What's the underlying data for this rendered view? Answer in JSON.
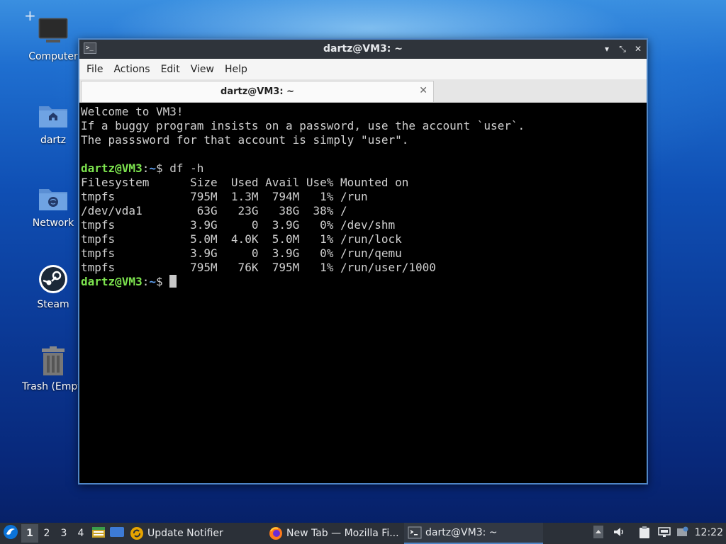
{
  "desktop": {
    "icons": [
      {
        "label": "Computer",
        "icon": "monitor-icon"
      },
      {
        "label": "dartz",
        "icon": "home-folder-icon"
      },
      {
        "label": "Network",
        "icon": "network-folder-icon"
      },
      {
        "label": "Steam",
        "icon": "steam-icon"
      },
      {
        "label": "Trash (Empty)",
        "icon": "trash-icon"
      }
    ]
  },
  "window": {
    "title": "dartz@VM3: ~",
    "menu": [
      "File",
      "Actions",
      "Edit",
      "View",
      "Help"
    ],
    "tab": {
      "label": "dartz@VM3: ~"
    },
    "controls": {
      "minimize": "▾",
      "maximize": "⤡",
      "close": "✕"
    }
  },
  "terminal": {
    "lines": [
      "Welcome to VM3!",
      "If a buggy program insists on a password, use the account `user`.",
      "The passsword for that account is simply \"user\"."
    ],
    "prompt_user": "dartz@VM3",
    "prompt_sep": ":",
    "prompt_path": "~",
    "prompt_dollar": "$ ",
    "command": "df -h",
    "df_output": [
      "Filesystem      Size  Used Avail Use% Mounted on",
      "tmpfs           795M  1.3M  794M   1% /run",
      "/dev/vda1        63G   23G   38G  38% /",
      "tmpfs           3.9G     0  3.9G   0% /dev/shm",
      "tmpfs           5.0M  4.0K  5.0M   1% /run/lock",
      "tmpfs           3.9G     0  3.9G   0% /run/qemu",
      "tmpfs           795M   76K  795M   1% /run/user/1000"
    ]
  },
  "taskbar": {
    "workspaces": [
      "1",
      "2",
      "3",
      "4"
    ],
    "active_workspace": "1",
    "tasks": [
      {
        "label": "Update Notifier",
        "icon": "update-notifier-icon"
      },
      {
        "label": "New Tab — Mozilla Fi...",
        "icon": "firefox-icon"
      },
      {
        "label": "dartz@VM3: ~",
        "icon": "terminal-icon"
      }
    ],
    "clock": "12:22"
  },
  "colors": {
    "prompt_user": "#7ce34e",
    "prompt_path": "#5fa0f0",
    "window_border": "#4f86c6",
    "taskbar_bg": "#2b3038"
  }
}
